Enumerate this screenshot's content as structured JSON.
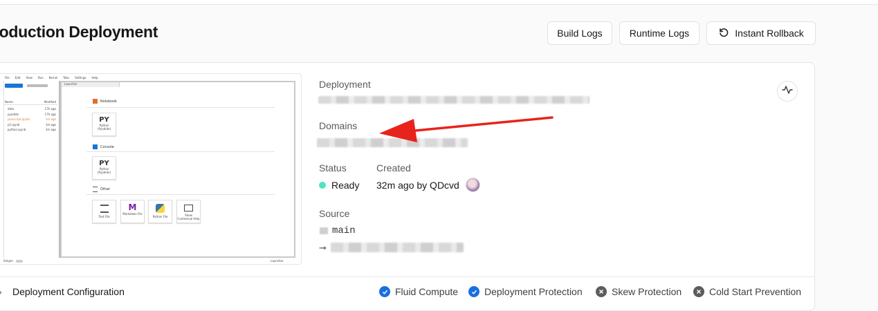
{
  "page_title": "roduction Deployment",
  "header_buttons": {
    "build_logs": "Build Logs",
    "runtime_logs": "Runtime Logs",
    "instant_rollback": "Instant Rollback"
  },
  "details": {
    "deployment_label": "Deployment",
    "domains_label": "Domains",
    "status_label": "Status",
    "status_value": "Ready",
    "created_label": "Created",
    "created_value": "32m ago by QDcvd",
    "source_label": "Source",
    "branch_value": "main"
  },
  "footer": {
    "config_label": "Deployment Configuration",
    "features": [
      {
        "label": "Fluid Compute",
        "enabled": true
      },
      {
        "label": "Deployment Protection",
        "enabled": true
      },
      {
        "label": "Skew Protection",
        "enabled": false
      },
      {
        "label": "Cold Start Prevention",
        "enabled": false
      }
    ]
  },
  "preview": {
    "menu": [
      "File",
      "Edit",
      "View",
      "Run",
      "Kernel",
      "Tabs",
      "Settings",
      "Help"
    ],
    "tab_label": "Launcher",
    "file_header": [
      "Name",
      "Modified"
    ],
    "files": [
      {
        "name": "data",
        "modified": "17h ago"
      },
      {
        "name": "pyodide",
        "modified": "17h ago"
      },
      {
        "name": "javascript.ipynb",
        "modified": "1m ago"
      },
      {
        "name": "p5.ipynb",
        "modified": "1m ago"
      },
      {
        "name": "python.ipynb",
        "modified": "1m ago"
      }
    ],
    "sections": [
      "Notebook",
      "Console",
      "Other"
    ],
    "kernel_label": "Python (Pyodide)",
    "other_tiles": [
      "Text File",
      "Markdown File",
      "Python File",
      "Show Contextual Help"
    ],
    "status_mode": "Simple",
    "status_right": "Launcher"
  },
  "colors": {
    "ready_dot": "#50e3c2",
    "feature_enabled": "#1a6fe0",
    "feature_disabled": "#5c5c5c",
    "annotation_arrow": "#e8231b"
  }
}
